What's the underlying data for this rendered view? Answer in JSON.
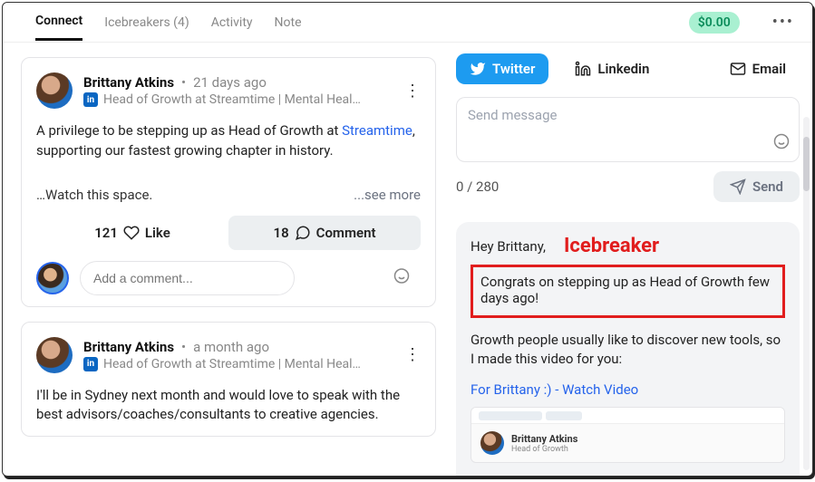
{
  "nav": {
    "tabs": [
      "Connect",
      "Icebreakers (4)",
      "Activity",
      "Note"
    ],
    "balance": "$0.00"
  },
  "posts": [
    {
      "author": "Brittany Atkins",
      "time": "21 days ago",
      "role": "Head of Growth at Streamtime | Mental Heal…",
      "body_pre": "A privilege to be stepping up as Head of Growth at ",
      "brand": "Streamtime",
      "body_post": ", supporting our fastest growing chapter in history.",
      "watch": "…Watch this space.",
      "seemore": "...see more",
      "likes": "121",
      "like_label": "Like",
      "comments": "18",
      "comment_label": "Comment",
      "add_comment_ph": "Add a comment..."
    },
    {
      "author": "Brittany Atkins",
      "time": "a month ago",
      "role": "Head of Growth at Streamtime | Mental Heal…",
      "body": "I'll be in Sydney next month and would love to speak with the best advisors/coaches/consultants to creative agencies."
    }
  ],
  "channels": {
    "twitter": "Twitter",
    "linkedin": "Linkedin",
    "email": "Email"
  },
  "compose": {
    "placeholder": "Send message",
    "counter": "0 / 280",
    "send": "Send"
  },
  "message": {
    "hey": "Hey Brittany,",
    "ice_label": "Icebreaker",
    "highlight": "Congrats on stepping up as Head of Growth few days ago!",
    "body": "Growth people usually like to discover new tools, so I made this video for you:",
    "video_link": "For Brittany :) - Watch Video",
    "preview_name": "Brittany Atkins",
    "preview_sub": "Head of Growth"
  },
  "li_badge": "in"
}
